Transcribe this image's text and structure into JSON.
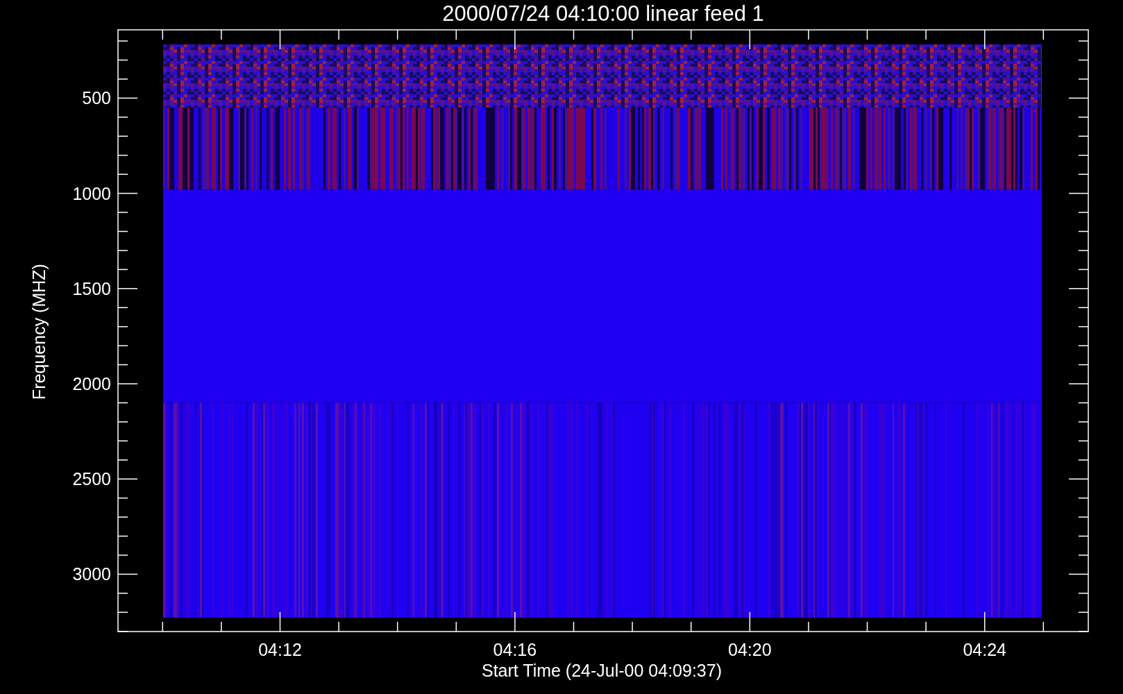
{
  "title": "2000/07/24 04:10:00 linear feed 1",
  "y_axis": {
    "label": "Frequency (MHZ)",
    "ticks": [
      "500",
      "1000",
      "1500",
      "2000",
      "2500",
      "3000"
    ]
  },
  "x_axis": {
    "label": "Start Time (24-Jul-00 04:09:37)",
    "ticks": [
      "04:12",
      "04:16",
      "04:20",
      "04:24"
    ]
  }
}
